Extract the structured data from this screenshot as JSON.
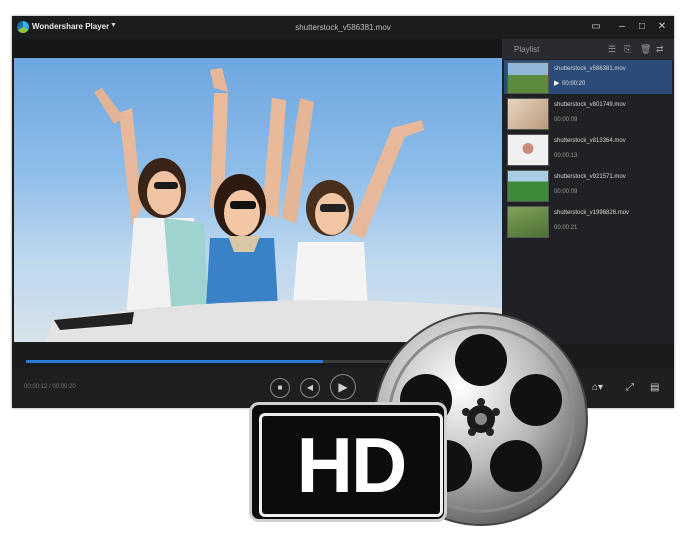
{
  "titlebar": {
    "app_name": "Wondershare Player",
    "app_caret": "▼",
    "file_name": "shutterstock_v586381.mov",
    "chat_icon": "▭",
    "minimize": "–",
    "maximize": "□",
    "close": "✕"
  },
  "playlist": {
    "title": "Playlist",
    "tools": [
      "☰",
      "⎘",
      "🗑",
      "⇄"
    ],
    "items": [
      {
        "name": "shutterstock_v586381.mov",
        "duration": "00:00:20",
        "active": true,
        "thumb": "#5c8b3e"
      },
      {
        "name": "shutterstock_v801749.mov",
        "duration": "00:00:09",
        "active": false,
        "thumb": "#b89a7a"
      },
      {
        "name": "shutterstock_v813364.mov",
        "duration": "00:00:13",
        "active": false,
        "thumb": "#dcdcdc"
      },
      {
        "name": "shutterstock_v921571.mov",
        "duration": "00:00:09",
        "active": false,
        "thumb": "#3f8a3a"
      },
      {
        "name": "shutterstock_v1996826.mov",
        "duration": "00:00:21",
        "active": false,
        "thumb": "#567d3c"
      }
    ]
  },
  "controls": {
    "time": "00:00:12 / 00:00:20",
    "progress": 0.63
  },
  "badge": {
    "text": "HD"
  },
  "colors": {
    "accent": "#2a7bd6",
    "active_row": "#2b4b78"
  }
}
